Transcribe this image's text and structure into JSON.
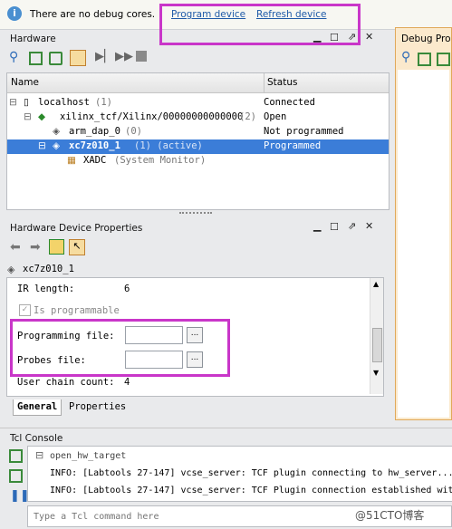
{
  "banner": {
    "message": "There are no debug cores.",
    "program_device": "Program device",
    "refresh_device": "Refresh device"
  },
  "hardware": {
    "title": "Hardware",
    "columns": {
      "name": "Name",
      "status": "Status"
    },
    "rows": [
      {
        "name": "localhost",
        "count": "(1)",
        "status": "Connected"
      },
      {
        "name": "xilinx_tcf/Xilinx/00000000000000",
        "count": "(2)",
        "status": "Open"
      },
      {
        "name": "arm_dap_0",
        "count": "(0)",
        "status": "Not programmed"
      },
      {
        "name": "xc7z010_1",
        "count": "(1) (active)",
        "status": "Programmed"
      },
      {
        "name": "XADC",
        "count": "(System Monitor)",
        "status": ""
      }
    ]
  },
  "debug_probes": {
    "title": "Debug Pro"
  },
  "properties": {
    "title": "Hardware Device Properties",
    "device": "xc7z010_1",
    "ir_length_label": "IR length:",
    "ir_length_value": "6",
    "is_programmable": "Is programmable",
    "programming_file_label": "Programming file:",
    "probes_file_label": "Probes file:",
    "user_chain_label": "User chain count:",
    "user_chain_value": "4",
    "tabs": [
      "General",
      "Properties"
    ]
  },
  "tcl": {
    "title": "Tcl Console",
    "lines": [
      "open_hw_target",
      "INFO: [Labtools 27-147] vcse_server: TCF plugin connecting to hw_server...",
      "INFO: [Labtools 27-147] vcse_server: TCF Plugin connection established with"
    ],
    "placeholder": "Type a Tcl command here"
  },
  "watermark": "@51CTO博客",
  "colors": {
    "highlight": "#c936c9",
    "selection": "#3b7dd8",
    "link": "#1e5aa8"
  }
}
